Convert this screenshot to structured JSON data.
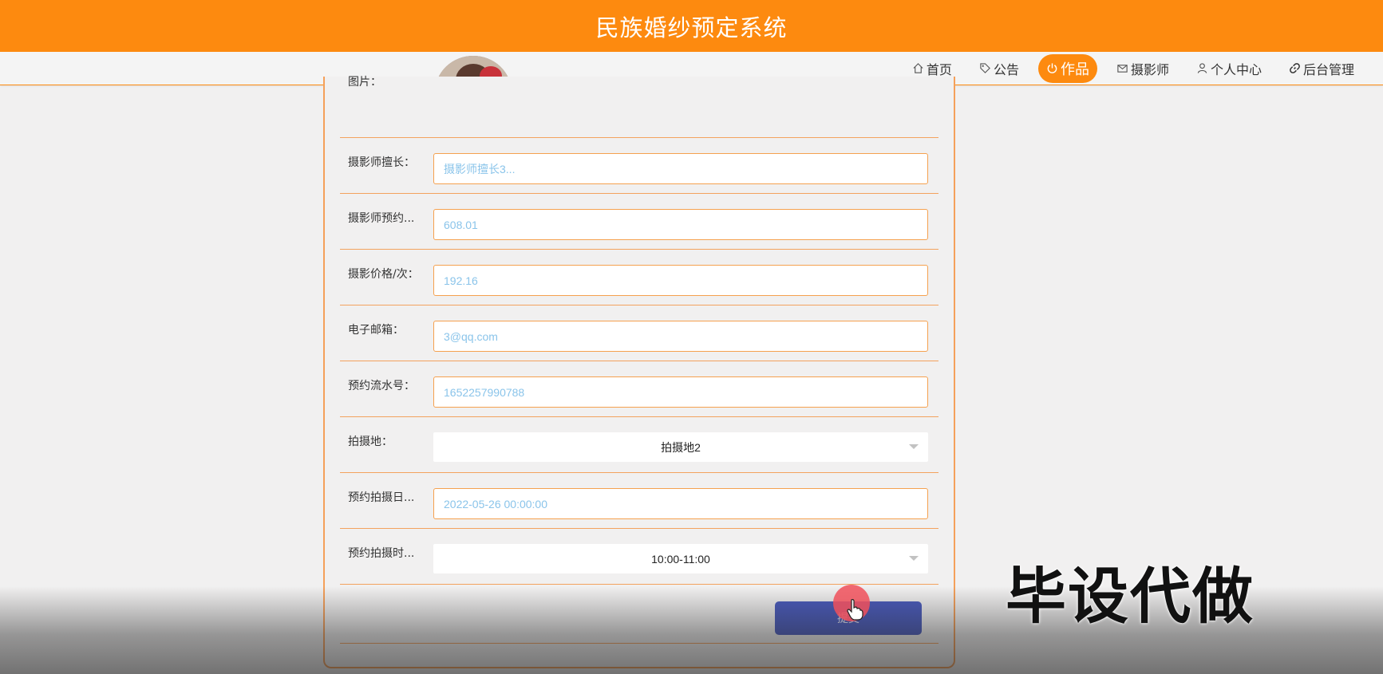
{
  "app": {
    "title": "民族婚纱预定系统"
  },
  "nav": {
    "items": [
      {
        "label": "首页",
        "icon": "home-icon",
        "active": false
      },
      {
        "label": "公告",
        "icon": "tag-icon",
        "active": false
      },
      {
        "label": "作品",
        "icon": "power-icon",
        "active": true
      },
      {
        "label": "摄影师",
        "icon": "mail-icon",
        "active": false
      },
      {
        "label": "个人中心",
        "icon": "user-icon",
        "active": false
      },
      {
        "label": "后台管理",
        "icon": "link-icon",
        "active": false
      }
    ]
  },
  "form": {
    "image_label": "图片：",
    "specialty": {
      "label": "摄影师擅长：",
      "value": "摄影师擅长3..."
    },
    "booking": {
      "label": "摄影师预约...",
      "value": "608.01"
    },
    "price": {
      "label": "摄影价格/次：",
      "value": "192.16"
    },
    "email": {
      "label": "电子邮箱：",
      "value": "3@qq.com"
    },
    "serial": {
      "label": "预约流水号：",
      "value": "1652257990788"
    },
    "location": {
      "label": "拍摄地：",
      "value": "拍摄地2"
    },
    "date": {
      "label": "预约拍摄日...",
      "value": "2022-05-26 00:00:00"
    },
    "time": {
      "label": "预约拍摄时...",
      "value": "10:00-11:00"
    },
    "submit_label": "提交"
  },
  "overlay": {
    "watermark": "毕设代做"
  },
  "colors": {
    "brand": "#fd8a0f",
    "button": "#4a5bbd",
    "field_text": "#8ac4ea"
  }
}
